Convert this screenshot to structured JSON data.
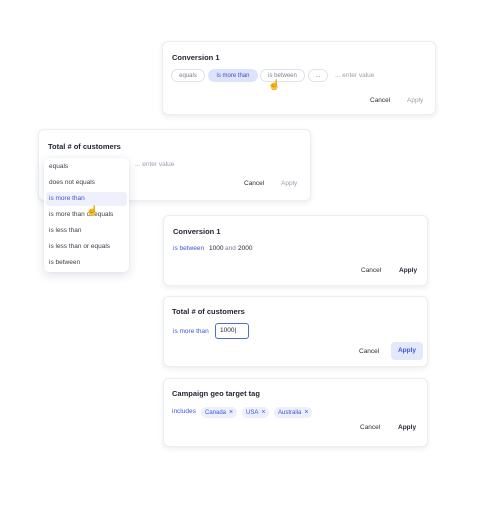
{
  "card1": {
    "title": "Conversion 1",
    "chips": [
      "equals",
      "is more than",
      "is between",
      "..."
    ],
    "placeholder": "... enter value",
    "cancel": "Cancel",
    "apply": "Apply"
  },
  "card2": {
    "title": "Total # of customers",
    "placeholder": "... enter value",
    "cancel": "Cancel",
    "apply": "Apply",
    "options": [
      "equals",
      "does not equals",
      "is more than",
      "is more than or equals",
      "is less than",
      "is less than or equals",
      "is between"
    ],
    "selected_option": "is more than"
  },
  "card3": {
    "title": "Conversion 1",
    "operator": "is between",
    "value_from": "1000",
    "connector": "and",
    "value_to": "2000",
    "cancel": "Cancel",
    "apply": "Apply"
  },
  "card4": {
    "title": "Total # of customers",
    "operator": "is more than",
    "input_value": "1000|",
    "cancel": "Cancel",
    "apply": "Apply"
  },
  "card5": {
    "title": "Campaign geo target tag",
    "operator": "includes",
    "tags": [
      "Canada",
      "USA",
      "Australia"
    ],
    "cancel": "Cancel",
    "apply": "Apply"
  },
  "icons": {
    "close": "×",
    "hand_cursor": "☝"
  }
}
